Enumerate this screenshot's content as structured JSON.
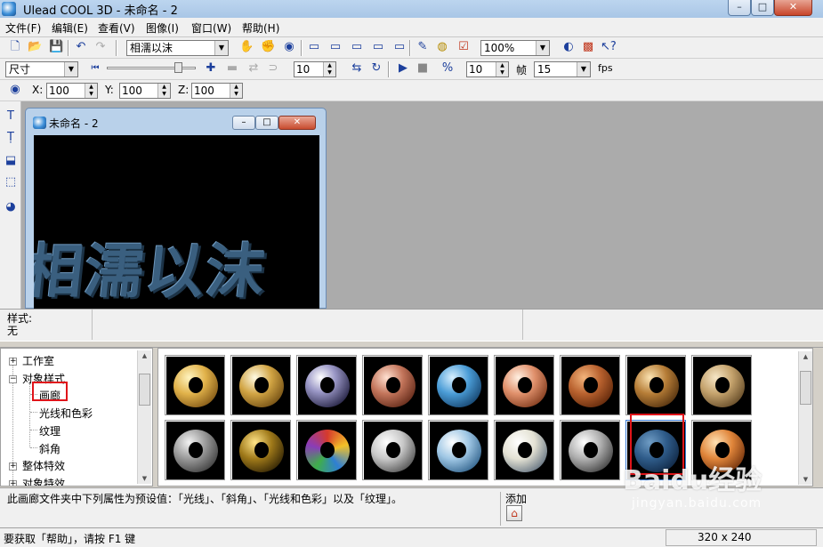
{
  "window": {
    "title": "Ulead COOL 3D - 未命名 - 2",
    "min": "–",
    "max": "□",
    "close": "✕"
  },
  "menu": [
    "文件(F)",
    "编辑(E)",
    "查看(V)",
    "图像(I)",
    "窗口(W)",
    "帮助(H)"
  ],
  "toolbar1": {
    "text_value": "相濡以沫",
    "zoom_value": "100%"
  },
  "toolbar2": {
    "size_value": "尺寸",
    "spin1": "10",
    "spin2": "10",
    "frames_label": "帧",
    "frames_value": "15",
    "fps_label": "fps"
  },
  "toolbar3": {
    "x_label": "X:",
    "x_value": "100",
    "y_label": "Y:",
    "y_value": "100",
    "z_label": "Z:",
    "z_value": "100"
  },
  "document": {
    "title": "未命名 - 2",
    "text": "相濡以沫",
    "canvas_bg": "#000000"
  },
  "style_panel": {
    "label": "样式:",
    "value": "无"
  },
  "tree": {
    "items": [
      {
        "label": "工作室",
        "expander": "+"
      },
      {
        "label": "对象样式",
        "expander": "−"
      },
      {
        "label": "画廊"
      },
      {
        "label": "光线和色彩"
      },
      {
        "label": "纹理"
      },
      {
        "label": "斜角"
      },
      {
        "label": "整体特效",
        "expander": "+"
      },
      {
        "label": "对象特效",
        "expander": "+"
      }
    ]
  },
  "gallery": {
    "row1": [
      "gold",
      "gold-shiny",
      "chrome-purple",
      "copper",
      "blue-marble",
      "salmon",
      "brick",
      "bronze",
      "leopard"
    ],
    "row2": [
      "stone-grey",
      "gold-spots",
      "stained-glass",
      "silver",
      "blue-sky",
      "white-pearl",
      "grey-rivets",
      "blue-rough",
      "orange-gradient"
    ],
    "selected_index": 16
  },
  "description": {
    "text": "此画廊文件夹中下列属性为预设值：「光线」、「斜角」、「光线和色彩」以及「纹理」。",
    "add_label": "添加"
  },
  "status": {
    "help_text": "要获取「帮助」，请按 F1 键",
    "dimensions": "320 x 240"
  },
  "watermark": {
    "brand": "Baidu经验",
    "url": "jingyan.baidu.com"
  }
}
